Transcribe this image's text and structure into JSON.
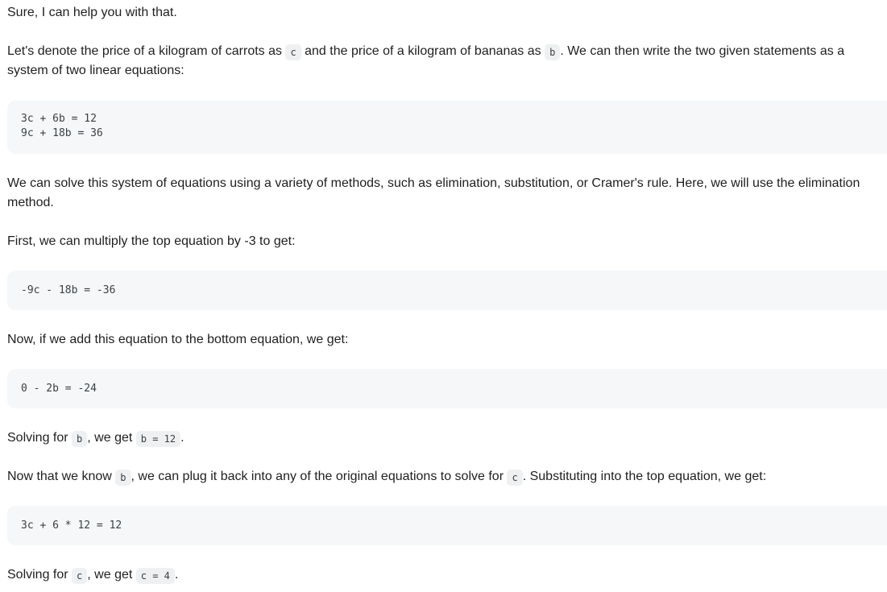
{
  "response": {
    "p1": "Sure, I can help you with that.",
    "p2": {
      "t1": "Let's denote the price of a kilogram of carrots as ",
      "c1": "c",
      "t2": " and the price of a kilogram of bananas as ",
      "c2": "b",
      "t3": ". We can then write the two given statements as a system of two linear equations:"
    },
    "code1": "3c + 6b = 12\n9c + 18b = 36",
    "p3": "We can solve this system of equations using a variety of methods, such as elimination, substitution, or Cramer's rule. Here, we will use the elimination method.",
    "p4": "First, we can multiply the top equation by -3 to get:",
    "code2": "-9c - 18b = -36",
    "p5": "Now, if we add this equation to the bottom equation, we get:",
    "code3": "0 - 2b = -24",
    "p6": {
      "t1": "Solving for ",
      "c1": "b",
      "t2": ", we get ",
      "c2": "b = 12",
      "t3": "."
    },
    "p7": {
      "t1": "Now that we know ",
      "c1": "b",
      "t2": ", we can plug it back into any of the original equations to solve for ",
      "c2": "c",
      "t3": ". Substituting into the top equation, we get:"
    },
    "code4": "3c + 6 * 12 = 12",
    "p8": {
      "t1": "Solving for ",
      "c1": "c",
      "t2": ", we get ",
      "c2": "c = 4",
      "t3": "."
    }
  }
}
